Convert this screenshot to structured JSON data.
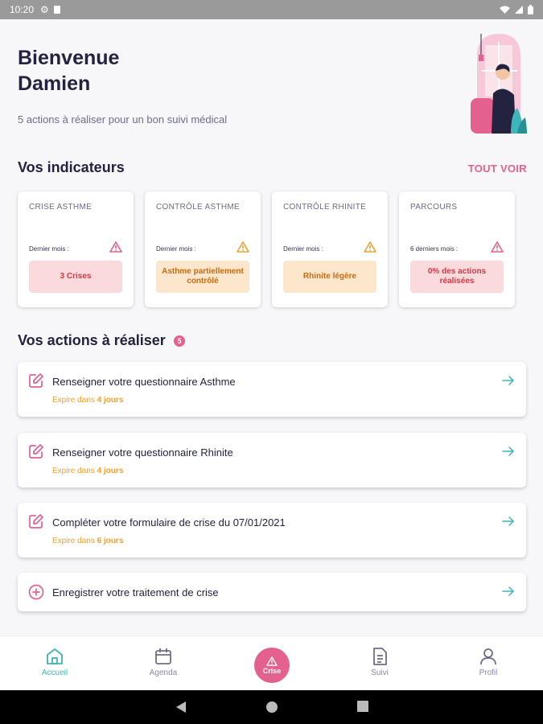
{
  "status_bar": {
    "time": "10:20",
    "icons": [
      "gear-icon",
      "sd-card-icon",
      "wifi-icon",
      "signal-icon",
      "battery-icon"
    ]
  },
  "header": {
    "greeting_line1": "Bienvenue",
    "greeting_line2": "Damien",
    "subtitle": "5 actions à réaliser pour un bon suivi médical"
  },
  "indicators": {
    "title": "Vos indicateurs",
    "see_all": "TOUT VOIR",
    "cards": [
      {
        "title": "CRISE ASTHME",
        "period": "Dernier mois :",
        "badge": "3 Crises",
        "badge_color": "red",
        "warning_color": "#e4608f"
      },
      {
        "title": "CONTRÔLE ASTHME",
        "period": "Dernier mois :",
        "badge": "Asthme partiellement contrôlé",
        "badge_color": "orange",
        "warning_color": "#f0a230"
      },
      {
        "title": "CONTRÔLE RHINITE",
        "period": "Dernier mois :",
        "badge": "Rhinite légère",
        "badge_color": "orange",
        "warning_color": "#f0a230"
      },
      {
        "title": "PARCOURS",
        "period": "6 derniers mois :",
        "badge": "0% des actions réalisées",
        "badge_color": "red",
        "warning_color": "#e4608f"
      }
    ]
  },
  "actions": {
    "title": "Vos actions à réaliser",
    "count": "5",
    "items": [
      {
        "title": "Renseigner votre questionnaire Asthme",
        "expiry_prefix": "Expire dans",
        "expiry_value": "4 jours",
        "icon": "edit-icon"
      },
      {
        "title": "Renseigner votre questionnaire Rhinite",
        "expiry_prefix": "Expire dans",
        "expiry_value": "4 jours",
        "icon": "edit-icon"
      },
      {
        "title": "Compléter votre formulaire de crise du 07/01/2021",
        "expiry_prefix": "Expire dans",
        "expiry_value": "6 jours",
        "icon": "edit-icon"
      },
      {
        "title": "Enregistrer votre traitement de crise",
        "icon": "plus-circle-icon"
      }
    ]
  },
  "bottom_nav": {
    "items": [
      {
        "label": "Accueil",
        "icon": "home-icon",
        "active": true
      },
      {
        "label": "Agenda",
        "icon": "calendar-icon",
        "active": false
      },
      {
        "label": "Crise",
        "icon": "warning-icon",
        "active": false
      },
      {
        "label": "Suivi",
        "icon": "document-icon",
        "active": false
      },
      {
        "label": "Profil",
        "icon": "user-icon",
        "active": false
      }
    ]
  },
  "colors": {
    "accent_pink": "#e4608f",
    "accent_teal": "#3cb6b8",
    "expiry_orange": "#f0a230"
  }
}
